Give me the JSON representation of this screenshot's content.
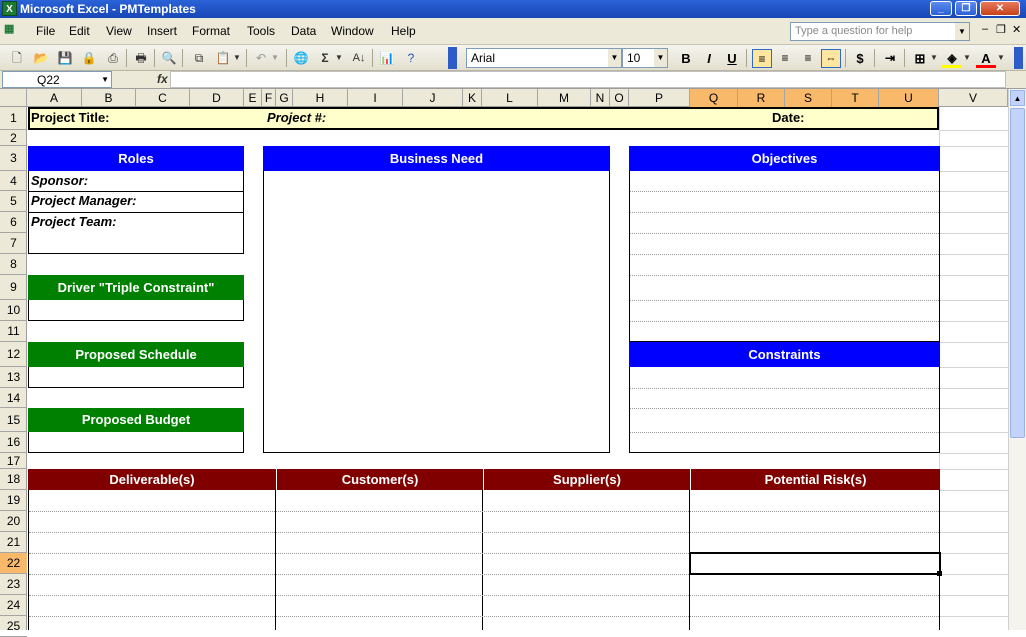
{
  "window": {
    "title": "Microsoft Excel - PMTemplates",
    "app_icon": "X"
  },
  "menu": [
    "File",
    "Edit",
    "View",
    "Insert",
    "Format",
    "Tools",
    "Data",
    "Window",
    "Help"
  ],
  "help_box": {
    "placeholder": "Type a question for help"
  },
  "toolbar": {
    "font": "Arial",
    "font_size": "10",
    "bold": "B",
    "italic": "I",
    "underline": "U",
    "currency": "$",
    "sigma": "Σ"
  },
  "formula_bar": {
    "name_box": "Q22",
    "fx": "fx",
    "content": ""
  },
  "columns": [
    "A",
    "B",
    "C",
    "D",
    "E",
    "F",
    "G",
    "H",
    "I",
    "J",
    "K",
    "L",
    "M",
    "N",
    "O",
    "P",
    "Q",
    "R",
    "S",
    "T",
    "U",
    "V"
  ],
  "selected_columns": [
    "Q",
    "R",
    "S",
    "T",
    "U"
  ],
  "rows": [
    "1",
    "2",
    "3",
    "4",
    "5",
    "6",
    "7",
    "8",
    "9",
    "10",
    "11",
    "12",
    "13",
    "14",
    "15",
    "16",
    "17",
    "18",
    "19",
    "20",
    "21",
    "22",
    "23",
    "24",
    "25"
  ],
  "selected_row": "22",
  "sheet": {
    "project_title": "Project Title:",
    "project_no": "Project #:",
    "date": "Date:",
    "roles": "Roles",
    "sponsor": "Sponsor:",
    "project_manager": "Project Manager:",
    "project_team": "Project Team:",
    "business_need": "Business Need",
    "objectives": "Objectives",
    "driver": "Driver \"Triple Constraint\"",
    "proposed_schedule": "Proposed Schedule",
    "proposed_budget": "Proposed Budget",
    "constraints": "Constraints",
    "deliverables": "Deliverable(s)",
    "customers": "Customer(s)",
    "suppliers": "Supplier(s)",
    "potential_risks": "Potential Risk(s)"
  },
  "colors": {
    "blue_header": "#0000ff",
    "green_header": "#008000",
    "red_header": "#800000",
    "title_fill": "#ffffcc",
    "selection": "#f9b96b"
  }
}
